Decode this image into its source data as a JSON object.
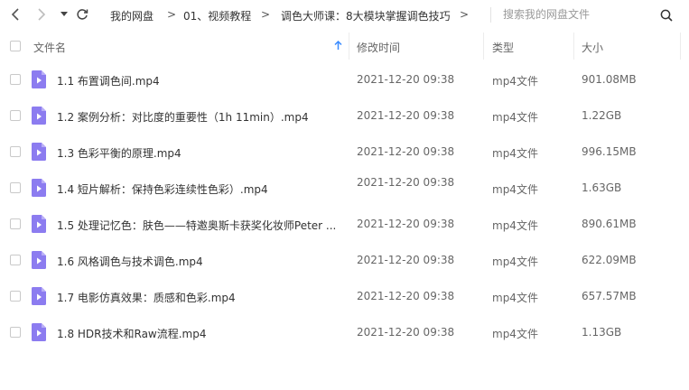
{
  "nav": {
    "back_icon": "chevron-left-icon",
    "forward_icon": "chevron-right-icon",
    "history_icon": "caret-down-icon",
    "refresh_icon": "refresh-icon"
  },
  "breadcrumb": {
    "items": [
      "我的网盘",
      "01、视频教程",
      "调色大师课：8大模块掌握调色技巧"
    ],
    "separator": ">"
  },
  "search": {
    "placeholder": "搜索我的网盘文件",
    "value": ""
  },
  "table": {
    "headers": {
      "name": "文件名",
      "modified": "修改时间",
      "type": "类型",
      "size": "大小"
    },
    "sort_icon": "arrow-up-icon",
    "rows": [
      {
        "name": "1.1 布置调色间.mp4",
        "modified": "2021-12-20 09:38",
        "type": "mp4文件",
        "size": "901.08MB"
      },
      {
        "name": "1.2 案例分析：对比度的重要性（1h 11min）.mp4",
        "modified": "2021-12-20 09:38",
        "type": "mp4文件",
        "size": "1.22GB"
      },
      {
        "name": "1.3 色彩平衡的原理.mp4",
        "modified": "2021-12-20 09:38",
        "type": "mp4文件",
        "size": "996.15MB"
      },
      {
        "name": "1.4 短片解析：保持色彩连续性色彩）.mp4",
        "modified": "2021-12-20 09:38",
        "type": "mp4文件",
        "size": "1.63GB"
      },
      {
        "name": "1.5 处理记忆色：肤色——特邀奥斯卡获奖化妆师Peter ...",
        "modified": "2021-12-20 09:38",
        "type": "mp4文件",
        "size": "890.61MB"
      },
      {
        "name": "1.6 风格调色与技术调色.mp4",
        "modified": "2021-12-20 09:38",
        "type": "mp4文件",
        "size": "622.09MB"
      },
      {
        "name": "1.7 电影仿真效果：质感和色彩.mp4",
        "modified": "2021-12-20 09:38",
        "type": "mp4文件",
        "size": "657.57MB"
      },
      {
        "name": "1.8 HDR技术和Raw流程.mp4",
        "modified": "2021-12-20 09:38",
        "type": "mp4文件",
        "size": "1.13GB"
      }
    ]
  },
  "colors": {
    "file_icon": "#8c7cf0",
    "file_icon_fold": "#b9aef7",
    "sort_arrow": "#3b8cff"
  }
}
